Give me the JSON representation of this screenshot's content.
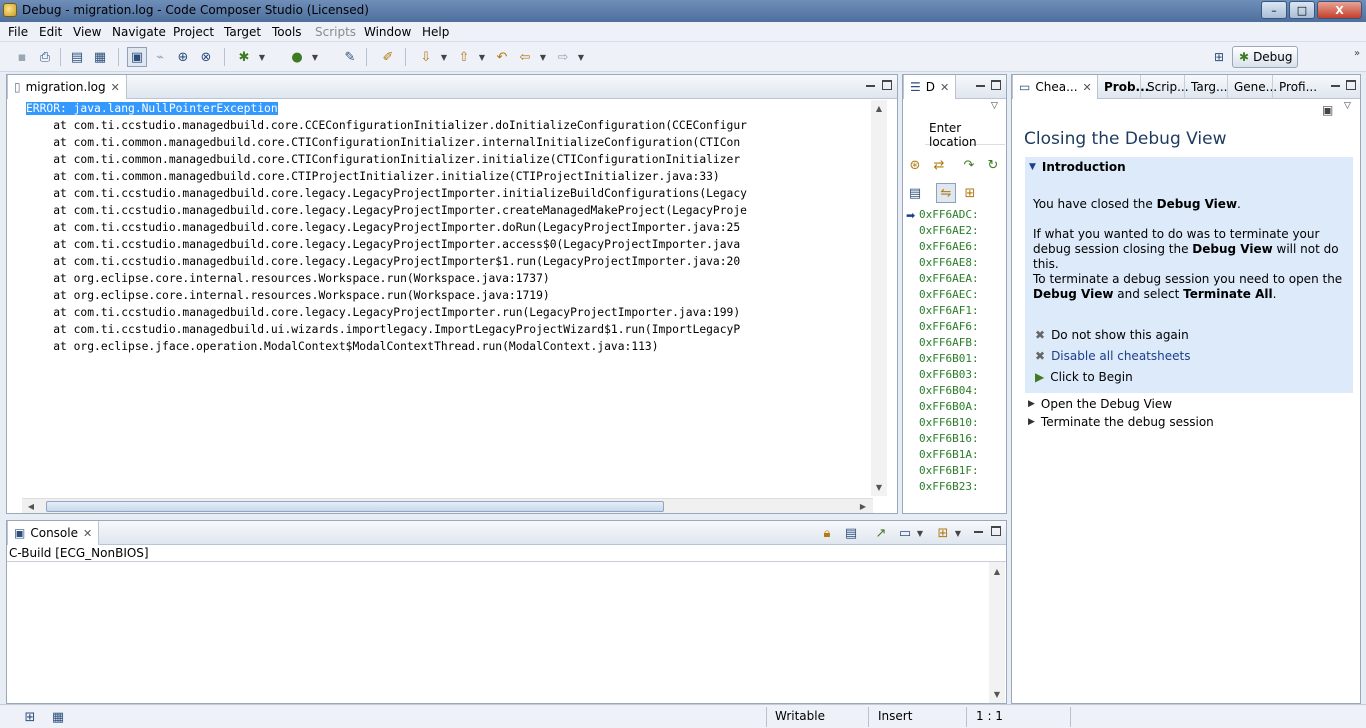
{
  "window": {
    "title": "Debug - migration.log - Code Composer Studio (Licensed)",
    "controls": {
      "minimize": "–",
      "maximize": "□",
      "close": "X"
    }
  },
  "menu": [
    "File",
    "Edit",
    "View",
    "Navigate",
    "Project",
    "Target",
    "Tools",
    "Scripts",
    "Window",
    "Help"
  ],
  "toolbar": {
    "perspective_label": "Debug"
  },
  "editor": {
    "tab_label": "migration.log",
    "lines": [
      "ERROR: java.lang.NullPointerException",
      "    at com.ti.ccstudio.managedbuild.core.CCEConfigurationInitializer.doInitializeConfiguration(CCEConfigur",
      "    at com.ti.common.managedbuild.core.CTIConfigurationInitializer.internalInitializeConfiguration(CTICon",
      "    at com.ti.common.managedbuild.core.CTIConfigurationInitializer.initialize(CTIConfigurationInitializer",
      "    at com.ti.common.managedbuild.core.CTIProjectInitializer.initialize(CTIProjectInitializer.java:33)",
      "    at com.ti.ccstudio.managedbuild.core.legacy.LegacyProjectImporter.initializeBuildConfigurations(Legacy",
      "    at com.ti.ccstudio.managedbuild.core.legacy.LegacyProjectImporter.createManagedMakeProject(LegacyProje",
      "    at com.ti.ccstudio.managedbuild.core.legacy.LegacyProjectImporter.doRun(LegacyProjectImporter.java:25",
      "    at com.ti.ccstudio.managedbuild.core.legacy.LegacyProjectImporter.access$0(LegacyProjectImporter.java",
      "    at com.ti.ccstudio.managedbuild.core.legacy.LegacyProjectImporter$1.run(LegacyProjectImporter.java:20",
      "    at org.eclipse.core.internal.resources.Workspace.run(Workspace.java:1737)",
      "    at org.eclipse.core.internal.resources.Workspace.run(Workspace.java:1719)",
      "    at com.ti.ccstudio.managedbuild.core.legacy.LegacyProjectImporter.run(LegacyProjectImporter.java:199)",
      "    at com.ti.ccstudio.managedbuild.ui.wizards.importlegacy.ImportLegacyProjectWizard$1.run(ImportLegacyP",
      "    at org.eclipse.jface.operation.ModalContext$ModalContextThread.run(ModalContext.java:113)"
    ]
  },
  "disassembly": {
    "tab_label": "D",
    "location_placeholder": "Enter location",
    "addresses": [
      "0xFF6ADC:",
      "0xFF6AE2:",
      "0xFF6AE6:",
      "0xFF6AE8:",
      "0xFF6AEA:",
      "0xFF6AEC:",
      "0xFF6AF1:",
      "0xFF6AF6:",
      "0xFF6AFB:",
      "0xFF6B01:",
      "0xFF6B03:",
      "0xFF6B04:",
      "0xFF6B0A:",
      "0xFF6B10:",
      "0xFF6B16:",
      "0xFF6B1A:",
      "0xFF6B1F:",
      "0xFF6B23:"
    ]
  },
  "cheatsheet": {
    "tabs": [
      "Chea...",
      "Prob...",
      "Scrip...",
      "Targ...",
      "Gene...",
      "Profi..."
    ],
    "title": "Closing the Debug View",
    "intro_heading": "Introduction",
    "p1_a": "You have closed the ",
    "p1_b": "Debug View",
    "p1_c": ".",
    "p2_a": "If what you wanted to do was to terminate your debug session closing the ",
    "p2_b": "Debug View",
    "p2_c": " will not do this.",
    "p3_a": "To terminate a debug session you need to open the ",
    "p3_b": "Debug View",
    "p3_c": " and select ",
    "p3_d": "Terminate All",
    "p3_e": ".",
    "actions": [
      "Do not show this again",
      "Disable all cheatsheets",
      "Click to Begin"
    ],
    "steps": [
      "Open the Debug View",
      "Terminate the debug session"
    ]
  },
  "console": {
    "tab_label": "Console",
    "build_label": "C-Build [ECG_NonBIOS]"
  },
  "status": {
    "mode": "Writable",
    "insert": "Insert",
    "position": "1 : 1"
  },
  "colors": {
    "selection": "#3399ff",
    "address_green": "#2a7d2a",
    "cheatsheet_bg": "#dceaf9"
  }
}
